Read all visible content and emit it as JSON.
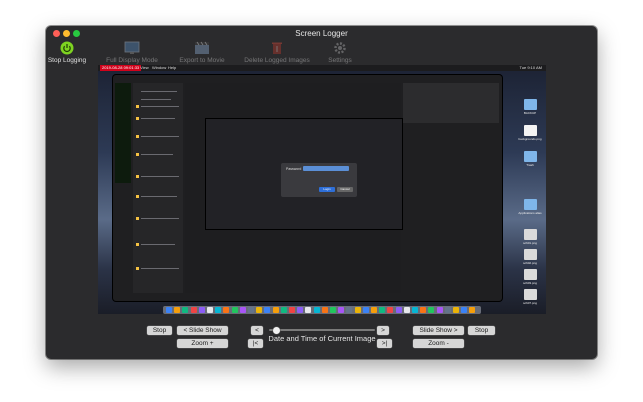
{
  "window": {
    "title": "Screen Logger"
  },
  "toolbar": {
    "items": [
      {
        "label": "Stop Logging",
        "icon": "power-icon"
      },
      {
        "label": "Full Display Mode",
        "icon": "display-icon"
      },
      {
        "label": "Export to Movie",
        "icon": "clapperboard-icon"
      },
      {
        "label": "Delete Logged Images",
        "icon": "trash-icon"
      },
      {
        "label": "Settings",
        "icon": "gear-icon"
      }
    ]
  },
  "screenshot": {
    "menubar": {
      "timestamp": "2019-08-28 09:01:33",
      "items": [
        "View",
        "Window",
        "Help"
      ],
      "right": "Tue 9:10 AM"
    },
    "desktop_icons": [
      {
        "label": "BACKUP"
      },
      {
        "label": "backgrounds.png"
      },
      {
        "label": "Trash"
      },
      {
        "label": "Applications alias"
      },
      {
        "label": "sch01.png"
      },
      {
        "label": "sch02.png"
      },
      {
        "label": "sch03.png"
      },
      {
        "label": "sch07.png"
      }
    ],
    "dialog": {
      "title": "Password",
      "login": "Login",
      "cancel": "Cancel"
    }
  },
  "controls": {
    "stop": "Stop",
    "prev_slideshow": "< Slide Show",
    "zoom_in": "Zoom +",
    "prev": "<",
    "first": "|<",
    "next": ">",
    "last": ">|",
    "next_slideshow": "Slide Show >",
    "stop_right": "Stop",
    "zoom_out": "Zoom -",
    "date_label": "Date and Time of Current Image",
    "slider_position": 0.04
  },
  "colors": {
    "accent_green": "#7ed321",
    "close": "#ff5f57",
    "minimize": "#febc2e",
    "maximize": "#28c840"
  }
}
